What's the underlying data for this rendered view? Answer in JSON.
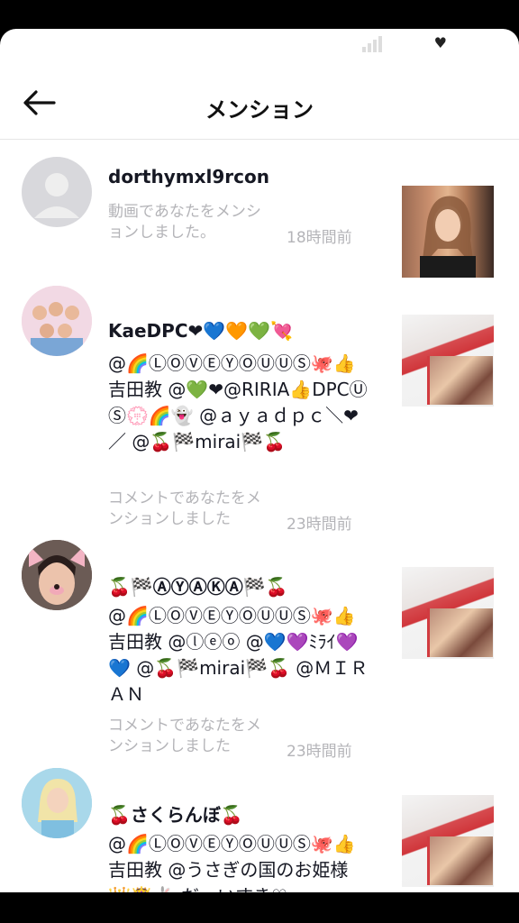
{
  "header": {
    "title": "メンション",
    "status_icon": "♥"
  },
  "notifications": [
    {
      "username": "dorthymxl9rcon",
      "comment": "",
      "meta": "動画であなたをメンションしました。",
      "time": "18時間前",
      "avatar": "default-avatar",
      "thumb": "woman-portrait"
    },
    {
      "username": "KaeDPC❤💙🧡💚💘",
      "comment": "@🌈ⓁⓄⓋⒺⓎⓄⓊⓊⓈ🐙👍吉田教 @💚❤@RIRIA👍DPCⓊⓈ💮🌈👻 @ａｙａｄｐｃ＼❤／ @🍒🏁mirai🏁🍒",
      "meta": "コメントであなたをメンションしました",
      "time": "23時間前",
      "avatar": "group-photo",
      "thumb": "red-room"
    },
    {
      "username": "🍒🏁ⒶⓎⒶⓀⒶ🏁🍒",
      "comment": "@🌈ⓁⓄⓋⒺⓎⓄⓊⓊⓈ🐙👍吉田教 @ⓛⓔⓞ @💙💜ﾐﾗｲ💜💙 @🍒🏁mirai🏁🍒 @ＭＩＲＡＮ",
      "meta": "コメントであなたをメンションしました",
      "time": "23時間前",
      "avatar": "dog-filter",
      "thumb": "red-room"
    },
    {
      "username": "🍒さくらんぼ🍒",
      "comment": "@🌈ⓁⓄⓋⒺⓎⓄⓊⓊⓈ🐙👍吉田教 @うさぎの国のお姫様👑👸🐇 だーいすき♡",
      "meta": "",
      "time": "",
      "avatar": "blonde-girl",
      "thumb": "red-room"
    }
  ]
}
